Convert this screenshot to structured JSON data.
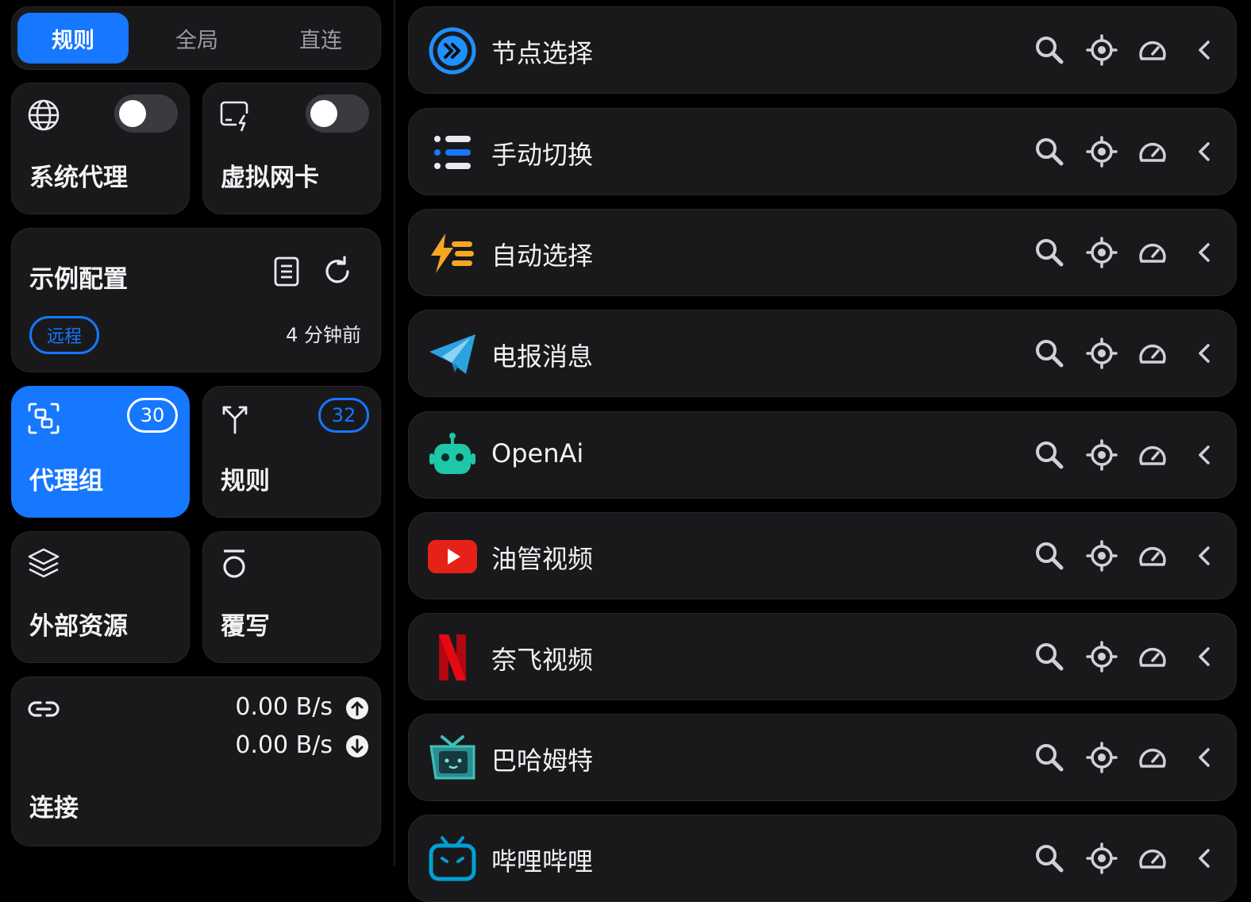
{
  "modes": {
    "items": [
      "规则",
      "全局",
      "直连"
    ],
    "active_index": 0
  },
  "system_proxy": {
    "label": "系统代理",
    "enabled": false
  },
  "tun": {
    "label": "虚拟网卡",
    "enabled": false
  },
  "profile": {
    "name": "示例配置",
    "type_badge": "远程",
    "updated": "4 分钟前"
  },
  "proxy_groups_tile": {
    "label": "代理组",
    "count": "30"
  },
  "rules_tile": {
    "label": "规则",
    "count": "32"
  },
  "resources_tile": {
    "label": "外部资源"
  },
  "override_tile": {
    "label": "覆写"
  },
  "connections": {
    "label": "连接",
    "upload": "0.00 B/s",
    "download": "0.00 B/s"
  },
  "groups": [
    {
      "name": "节点选择",
      "icon": "double-chevron-circle-icon"
    },
    {
      "name": "手动切换",
      "icon": "list-icon"
    },
    {
      "name": "自动选择",
      "icon": "lightning-list-icon"
    },
    {
      "name": "电报消息",
      "icon": "telegram-icon"
    },
    {
      "name": "OpenAi",
      "icon": "robot-icon"
    },
    {
      "name": "油管视频",
      "icon": "youtube-icon"
    },
    {
      "name": "奈飞视频",
      "icon": "netflix-icon"
    },
    {
      "name": "巴哈姆特",
      "icon": "bahamut-tv-icon"
    },
    {
      "name": "哔哩哔哩",
      "icon": "bilibili-icon"
    }
  ],
  "colors": {
    "accent": "#1677ff",
    "card": "#19191c",
    "background": "#000000"
  }
}
